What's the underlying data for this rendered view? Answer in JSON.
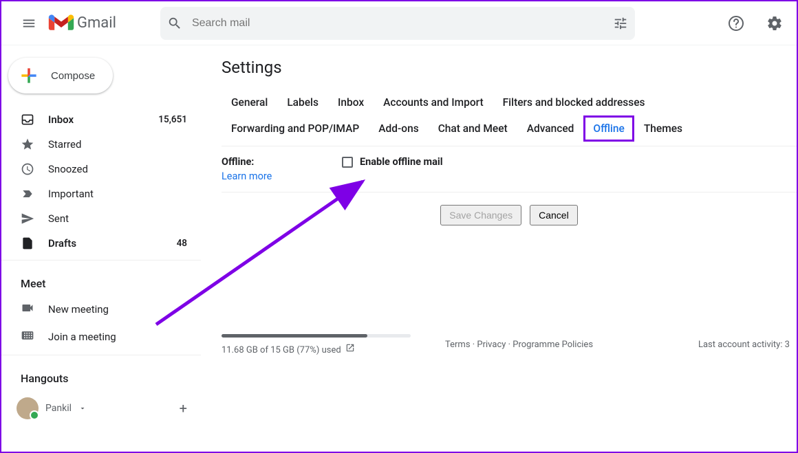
{
  "header": {
    "app_name": "Gmail",
    "search_placeholder": "Search mail"
  },
  "sidebar": {
    "compose_label": "Compose",
    "items": [
      {
        "icon": "inbox",
        "label": "Inbox",
        "count": "15,651",
        "bold": true
      },
      {
        "icon": "star",
        "label": "Starred",
        "count": "",
        "bold": false
      },
      {
        "icon": "clock",
        "label": "Snoozed",
        "count": "",
        "bold": false
      },
      {
        "icon": "important",
        "label": "Important",
        "count": "",
        "bold": false
      },
      {
        "icon": "send",
        "label": "Sent",
        "count": "",
        "bold": false
      },
      {
        "icon": "drafts",
        "label": "Drafts",
        "count": "48",
        "bold": true
      }
    ],
    "meet_title": "Meet",
    "meet_items": [
      {
        "icon": "video",
        "label": "New meeting"
      },
      {
        "icon": "keyboard",
        "label": "Join a meeting"
      }
    ],
    "hangouts_title": "Hangouts",
    "hangouts_user": "Pankil"
  },
  "settings": {
    "page_title": "Settings",
    "tabs": [
      "General",
      "Labels",
      "Inbox",
      "Accounts and Import",
      "Filters and blocked addresses",
      "Forwarding and POP/IMAP",
      "Add-ons",
      "Chat and Meet",
      "Advanced",
      "Offline",
      "Themes"
    ],
    "active_tab": "Offline",
    "offline": {
      "section_label": "Offline:",
      "learn_more": "Learn more",
      "checkbox_label": "Enable offline mail",
      "checked": false
    },
    "buttons": {
      "save": "Save Changes",
      "cancel": "Cancel"
    }
  },
  "footer": {
    "storage_text": "11.68 GB of 15 GB (77%) used",
    "storage_percent": 77,
    "links": [
      "Terms",
      "Privacy",
      "Programme Policies"
    ],
    "activity": "Last account activity: 3"
  },
  "annotation": {
    "highlight_tab": "Offline",
    "arrow_color": "#7e00e6"
  }
}
